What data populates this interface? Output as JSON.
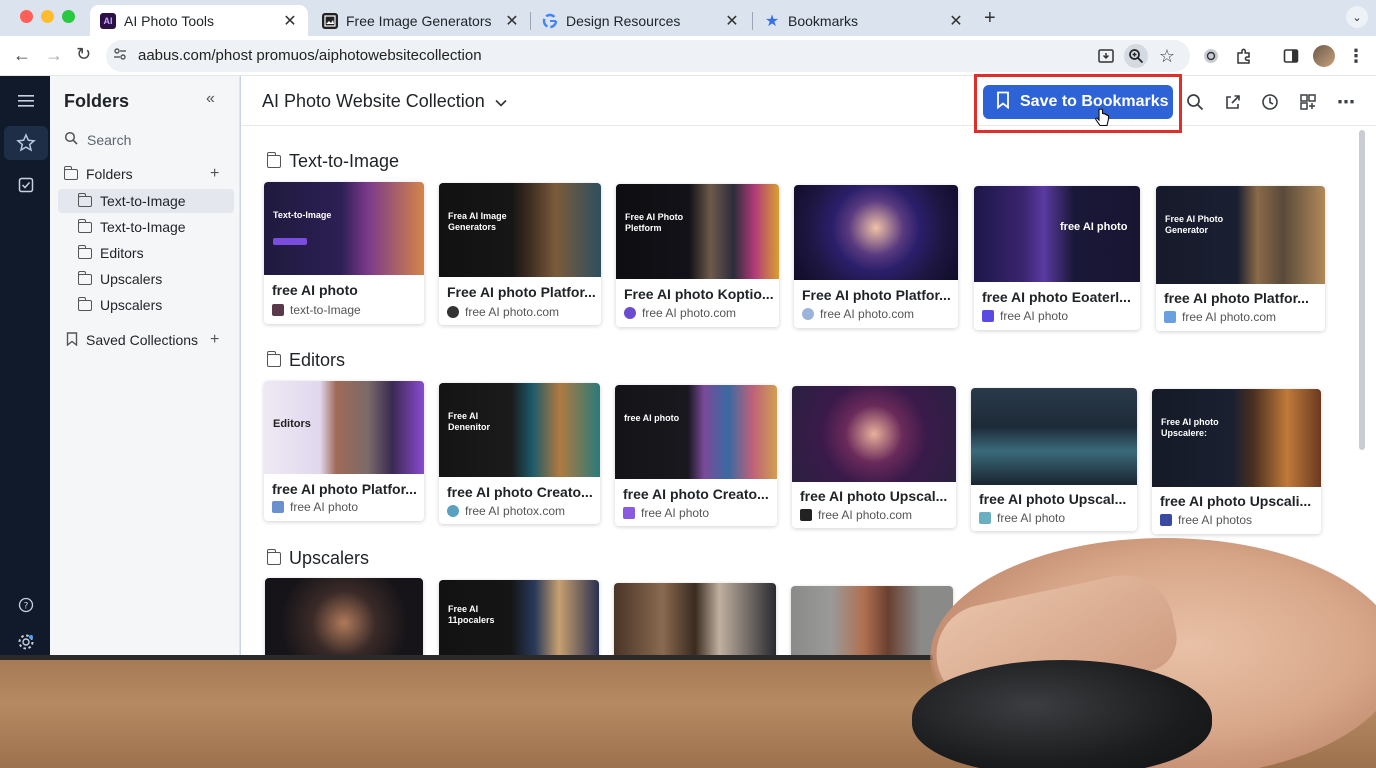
{
  "browser": {
    "tabs": [
      {
        "title": "AI Photo Tools",
        "favicon": "AI",
        "active": true
      },
      {
        "title": "Free Image Generators",
        "favicon": "image-icon",
        "active": false
      },
      {
        "title": "Design Resources",
        "favicon": "google-icon",
        "active": false
      },
      {
        "title": "Bookmarks",
        "favicon": "star-icon",
        "active": false
      }
    ],
    "url": "aabus.com/phost promuos/aiphotowebsitecollection"
  },
  "sidebar": {
    "title": "Folders",
    "search_placeholder": "Search",
    "folders_label": "Folders",
    "items": [
      "Text-to-Image",
      "Text-to-Image",
      "Editors",
      "Upscalers",
      "Upscalers"
    ],
    "saved_label": "Saved Collections"
  },
  "main": {
    "title": "AI Photo Website Collection",
    "save_button": "Save to Bookmarks",
    "sections": [
      {
        "name": "Text-to-Image",
        "cards": [
          {
            "title": "free AI photo",
            "source": "text-to-Image",
            "thumb_text": "Text-to-Image"
          },
          {
            "title": "Free AI photo Platfor...",
            "source": "free AI photo.com",
            "thumb_text": "Frea AI Image Generators"
          },
          {
            "title": "Free AI photo Koptio...",
            "source": "free AI photo.com",
            "thumb_text": "Free AI Photo Pletform"
          },
          {
            "title": "Free AI photo Platfor...",
            "source": "free AI photo.com",
            "thumb_text": ""
          },
          {
            "title": "free AI photo Eoaterl...",
            "source": "free AI photo",
            "thumb_text": "free AI photo"
          },
          {
            "title": "free AI photo Platfor...",
            "source": "free AI photo.com",
            "thumb_text": "Free AI Photo Generator"
          }
        ]
      },
      {
        "name": "Editors",
        "cards": [
          {
            "title": "free AI photo Platfor...",
            "source": "free AI photo",
            "thumb_text": "Editors"
          },
          {
            "title": "free AI photo Creato...",
            "source": "free AI photox.com",
            "thumb_text": "Free AI Denenitor"
          },
          {
            "title": "free AI photo Creato...",
            "source": "free AI photo",
            "thumb_text": "free AI photo"
          },
          {
            "title": "free AI photo Upscal...",
            "source": "free AI photo.com",
            "thumb_text": ""
          },
          {
            "title": "free AI photo Upscal...",
            "source": "free AI photo",
            "thumb_text": ""
          },
          {
            "title": "free AI photo Upscali...",
            "source": "free AI photos",
            "thumb_text": "Free AI photo Upscalere:"
          }
        ]
      },
      {
        "name": "Upscalers",
        "cards": [
          {
            "thumb_text": ""
          },
          {
            "thumb_text": "Free AI 11pocalers"
          },
          {
            "thumb_text": ""
          },
          {
            "thumb_text": ""
          },
          {
            "thumb_text": ""
          }
        ]
      }
    ]
  },
  "colors": {
    "accent": "#2e63d8",
    "highlight": "#e02e2b",
    "rail": "#101a2a"
  }
}
